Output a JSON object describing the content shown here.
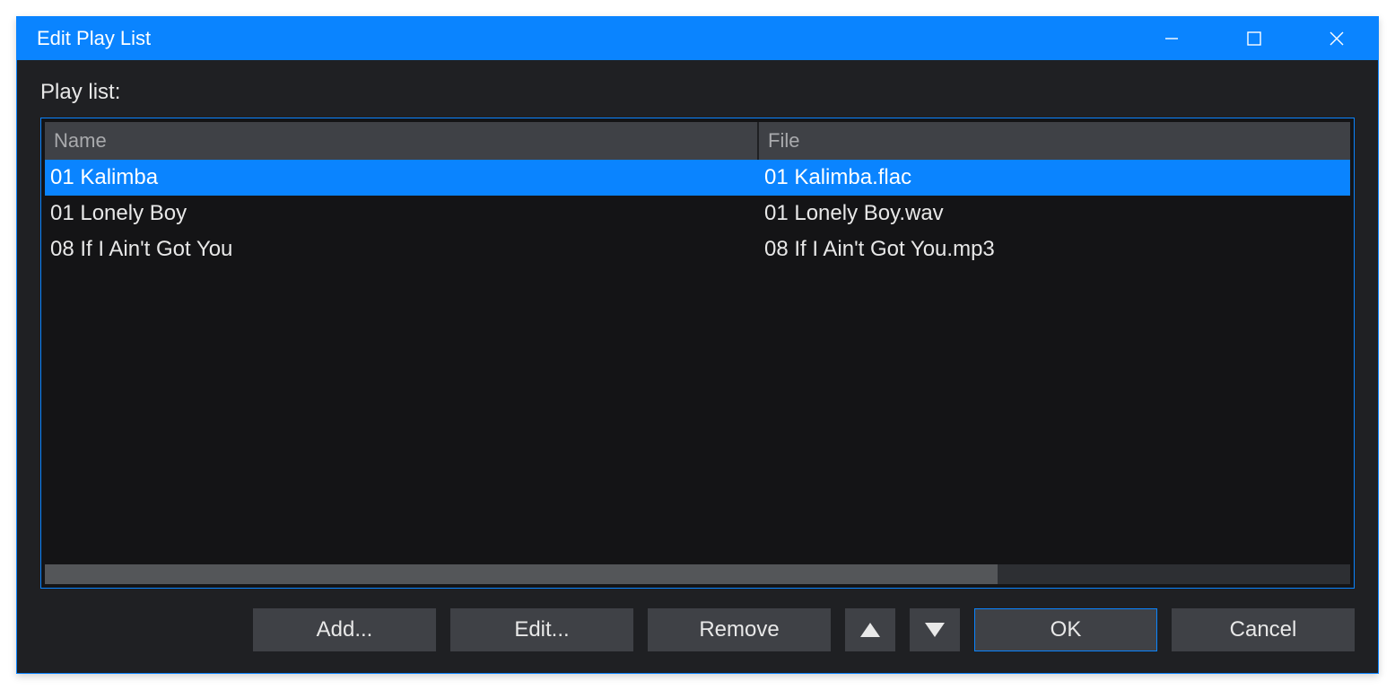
{
  "window": {
    "title": "Edit Play List"
  },
  "section": {
    "label": "Play list:"
  },
  "columns": {
    "name": "Name",
    "file": "File"
  },
  "rows": [
    {
      "name": "01 Kalimba",
      "file": "01 Kalimba.flac",
      "selected": true
    },
    {
      "name": "01 Lonely Boy",
      "file": "01 Lonely Boy.wav",
      "selected": false
    },
    {
      "name": "08 If I Ain't Got You",
      "file": "08 If I Ain't Got You.mp3",
      "selected": false
    }
  ],
  "buttons": {
    "add": "Add...",
    "edit": "Edit...",
    "remove": "Remove",
    "ok": "OK",
    "cancel": "Cancel"
  }
}
